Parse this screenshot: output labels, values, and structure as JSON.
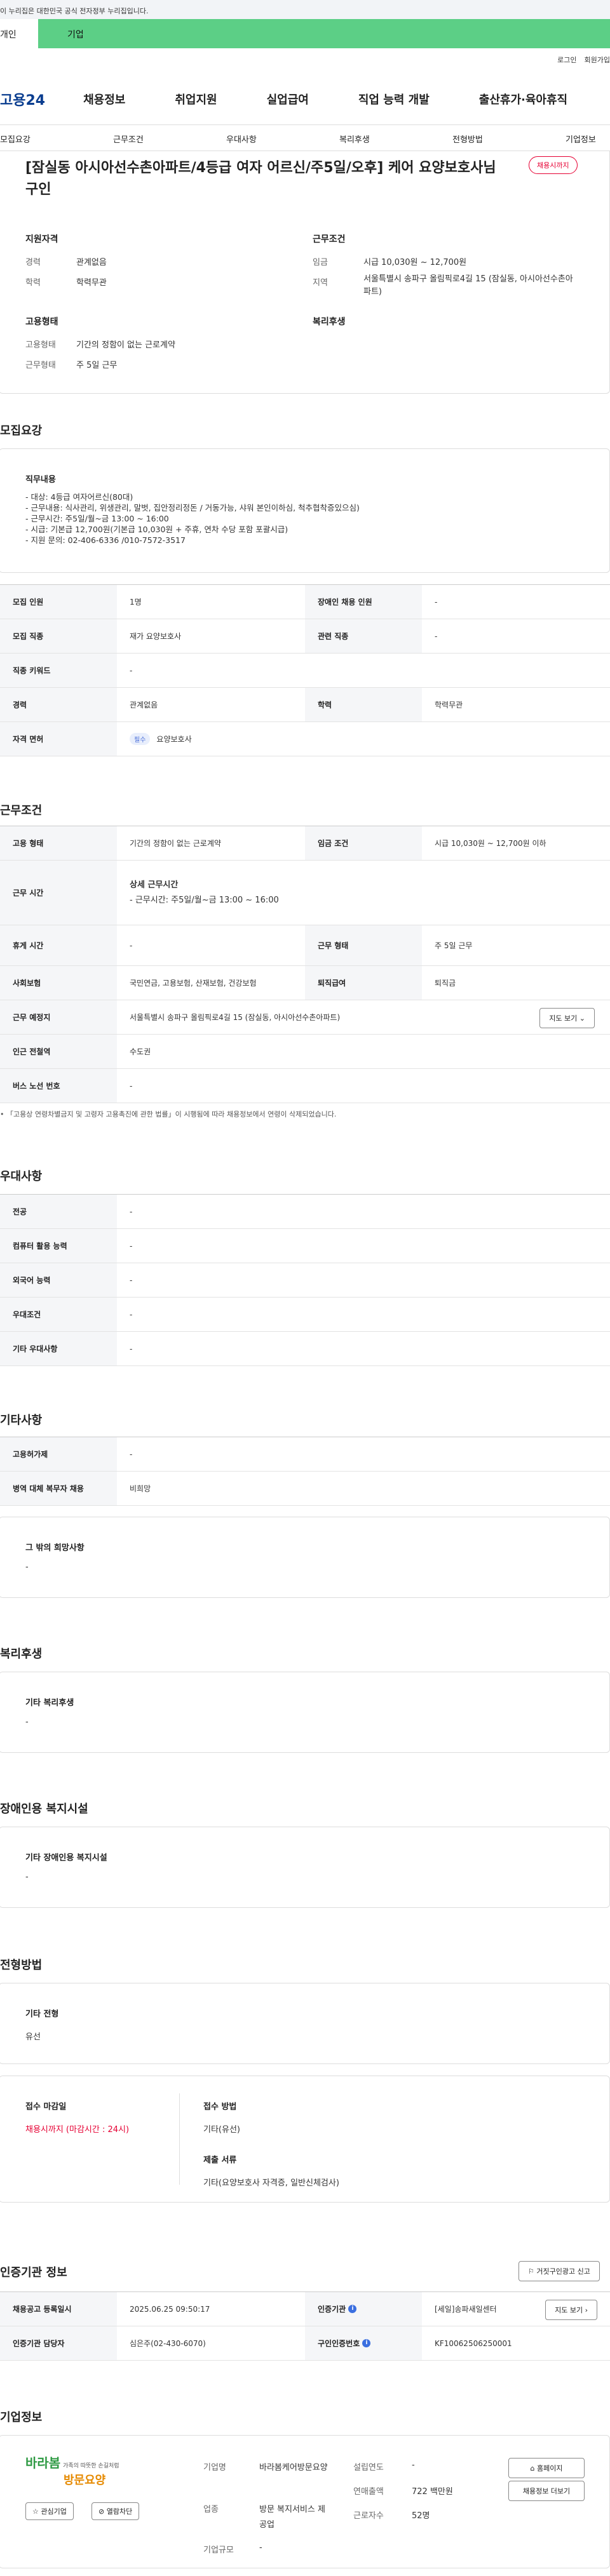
{
  "gov_banner": "이 누리집은 대한민국 공식 전자정부 누리집입니다.",
  "top_tabs": [
    "개인",
    "기업"
  ],
  "util_links": [
    "로그인",
    "회원가입"
  ],
  "logo": "고용24",
  "nav": [
    "채용정보",
    "취업지원",
    "실업급여",
    "직업 능력 개발",
    "출산휴가·육아휴직"
  ],
  "subnav": [
    "모집요강",
    "근무조건",
    "우대사항",
    "복리후생",
    "전형방법",
    "기업정보"
  ],
  "job_title": "[잠실동 아시아선수촌아파트/4등급 여자 어르신/주5일/오후] 케어 요양보호사님 구인",
  "status_badge": "채용시까지",
  "summary": {
    "qual_title": "지원자격",
    "career_k": "경력",
    "career_v": "관계없음",
    "edu_k": "학력",
    "edu_v": "학력무관",
    "emp_title": "고용형태",
    "emptype_k": "고용형태",
    "emptype_v": "기간의 정함이 없는 근로계약",
    "workform_k": "근무형태",
    "workform_v": "주 5일 근무",
    "cond_title": "근무조건",
    "wage_k": "임금",
    "wage_v": "시급 10,030원 ~ 12,700원",
    "region_k": "지역",
    "region_v": "서울특별시 송파구 올림픽로4길 15 (잠실동, 아시아선수촌아파트)",
    "welfare_title": "복리후생"
  },
  "recruit": {
    "section": "모집요강",
    "duty_title": "직무내용",
    "duty_lines": [
      "- 대상: 4등급 여자어르신(80대)",
      "- 근무내용: 식사관리, 위생관리, 말벗, 집안정리정돈 / 거동가능, 샤워 본인이하심, 척추협착증있으심)",
      "- 근무시간: 주5일/월~금 13:00 ~ 16:00",
      "- 시급: 기본급 12,700원(기본급 10,030원 + 주휴, 연차 수당 포함 포괄시급)",
      "- 지원 문의: 02-406-6336 /010-7572-3517"
    ],
    "rows": [
      {
        "k1": "모집 인원",
        "v1": "1명",
        "k2": "장애인 채용 인원",
        "v2": "-"
      },
      {
        "k1": "모집 직종",
        "v1": "재가 요양보호사",
        "k2": "관련 직종",
        "v2": "-"
      },
      {
        "k1": "직종 키워드",
        "v1": "-"
      },
      {
        "k1": "경력",
        "v1": "관계없음",
        "k2": "학력",
        "v2": "학력무관"
      },
      {
        "k1": "자격 면허",
        "pill": "필수",
        "v1": "요양보호사"
      }
    ]
  },
  "work": {
    "section": "근무조건",
    "emp_k": "고용 형태",
    "emp_v": "기간의 정함이 없는 근로계약",
    "wage_k": "임금 조건",
    "wage_v": "시급 10,030원 ~ 12,700원 이하",
    "time_k": "근무 시간",
    "time_t": "상세 근무시간",
    "time_v": "- 근무시간: 주5일/월~금 13:00 ~ 16:00",
    "rest_k": "휴게 시간",
    "rest_v": "-",
    "form_k": "근무 형태",
    "form_v": "주 5일 근무",
    "ins_k": "사회보험",
    "ins_v": "국민연금, 고용보험, 산재보험, 건강보험",
    "ret_k": "퇴직급여",
    "ret_v": "퇴직금",
    "place_k": "근무 예정지",
    "place_v": "서울특별시 송파구 올림픽로4길 15 (잠실동, 아시아선수촌아파트)",
    "map_btn": "지도 보기",
    "subway_k": "인근 전철역",
    "subway_v": "수도권",
    "bus_k": "버스 노선 번호",
    "bus_v": "-",
    "note": "「고용상 연령차별금지 및 고령자 고용촉진에 관한 법률」이 시행됨에 따라 채용정보에서 연령이 삭제되었습니다."
  },
  "pref": {
    "section": "우대사항",
    "rows": [
      {
        "k": "전공",
        "v": "-"
      },
      {
        "k": "컴퓨터 활용 능력",
        "v": "-"
      },
      {
        "k": "외국어 능력",
        "v": "-"
      },
      {
        "k": "우대조건",
        "v": "-"
      },
      {
        "k": "기타 우대사항",
        "v": "-"
      }
    ]
  },
  "etc": {
    "section": "기타사항",
    "rows": [
      {
        "k": "고용허가제",
        "v": "-"
      },
      {
        "k": "병역 대체 복무자 채용",
        "v": "비희망"
      }
    ],
    "other_title": "그 밖의 희망사항",
    "other_v": "-"
  },
  "welfare": {
    "section": "복리후생",
    "title": "기타 복리후생",
    "v": "-"
  },
  "disabled": {
    "section": "장애인용 복지시설",
    "title": "기타 장애인용 복지시설",
    "v": "-"
  },
  "selection": {
    "section": "전형방법",
    "title": "기타 전형",
    "v": "유선",
    "deadline_t": "접수 마감일",
    "deadline_v": "채용시까지 (마감시간 : 24시)",
    "method_t": "접수 방법",
    "method_v": "기타(유선)",
    "docs_t": "제출 서류",
    "docs_v": "기타(요양보호사 자격증, 일반신체검사)"
  },
  "agency": {
    "section": "인증기관 정보",
    "report_btn": "거짓구인광고 신고",
    "reg_k": "채용공고 등록일시",
    "reg_v": "2025.06.25 09:50:17",
    "org_k": "인증기관",
    "org_v": "[세일]송파새일센터",
    "map_btn": "지도 보기",
    "mgr_k": "인증기관 담당자",
    "mgr_v": "심은주(02-430-6070)",
    "auth_k": "구인인증번호",
    "auth_v": "KF10062506250001"
  },
  "company": {
    "section": "기업정보",
    "logo_main": "바라봄",
    "logo_sub": "가족의 따뜻한 손길처럼",
    "logo_name": "방문요양",
    "fav_btn": "관심기업",
    "block_btn": "열람차단",
    "name_k": "기업명",
    "name_v": "바라봄케어방문요양",
    "year_k": "설립연도",
    "year_v": "-",
    "ind_k": "업종",
    "ind_v": "방문 복지서비스 제공업",
    "sales_k": "연매출액",
    "sales_v": "722 백만원",
    "emp_k": "근로자수",
    "emp_v": "52명",
    "size_k": "기업규모",
    "size_v": "-",
    "home_btn": "홈페이지",
    "jobs_btn": "채용정보 더보기"
  }
}
